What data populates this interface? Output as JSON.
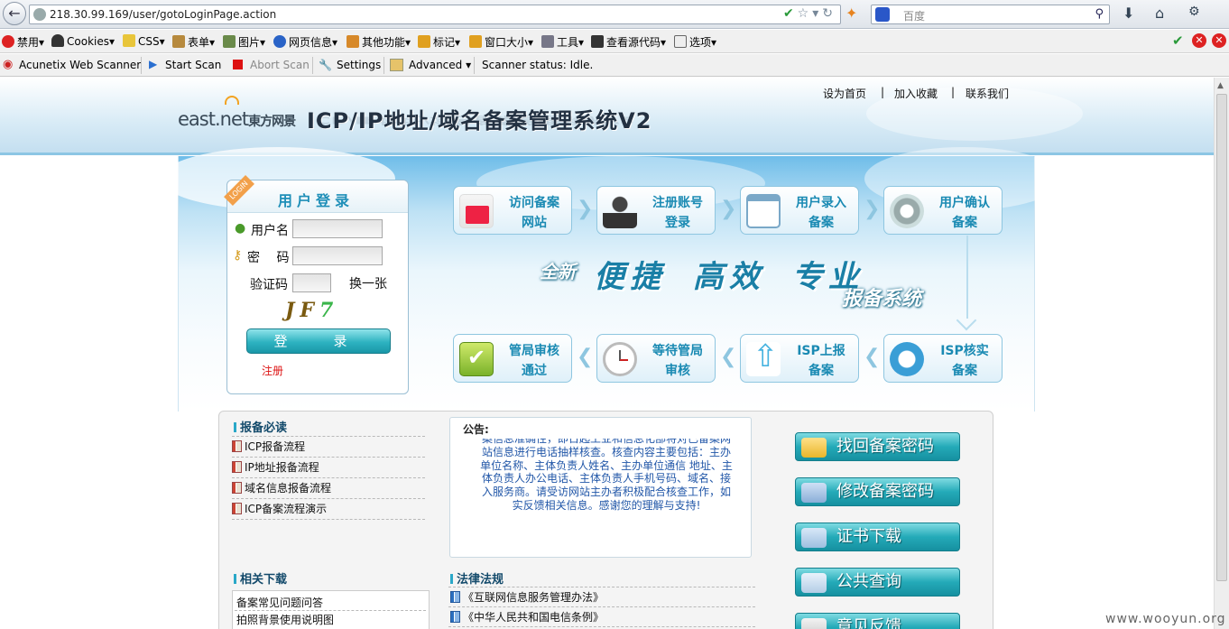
{
  "browser": {
    "url": "218.30.99.169/user/gotoLoginPage.action",
    "search_placeholder": "百度"
  },
  "webdev_toolbar": [
    "禁用",
    "Cookies",
    "CSS",
    "表单",
    "图片",
    "网页信息",
    "其他功能",
    "标记",
    "窗口大小",
    "工具",
    "查看源代码",
    "选项"
  ],
  "acunetix_bar": {
    "brand": "Acunetix Web Scanner",
    "start": "Start Scan",
    "abort": "Abort Scan",
    "settings": "Settings",
    "advanced": "Advanced",
    "status": "Scanner status: Idle."
  },
  "header": {
    "logo_en": "east.net",
    "logo_cn": "東方网景",
    "title": "ICP/IP地址/域名备案管理系统V2",
    "links": [
      "设为首页",
      "|",
      "加入收藏",
      "|",
      "联系我们"
    ]
  },
  "login": {
    "title": "用户登录",
    "tag": "LOGIN",
    "username_label": "用户名",
    "password_label": "密　 码",
    "captcha_label": "验证码",
    "refresh": "换一张",
    "captcha_text": "JF",
    "submit": "登　录",
    "register": "注册"
  },
  "flow": {
    "top": [
      {
        "line1": "访问备案",
        "line2": "网站"
      },
      {
        "line1": "注册账号",
        "line2": "登录"
      },
      {
        "line1": "用户录入",
        "line2": "备案"
      },
      {
        "line1": "用户确认",
        "line2": "备案"
      }
    ],
    "bottom": [
      {
        "line1": "管局审核",
        "line2": "通过"
      },
      {
        "line1": "等待管局",
        "line2": "审核"
      },
      {
        "line1": "ISP上报",
        "line2": "备案"
      },
      {
        "line1": "ISP核实",
        "line2": "备案"
      }
    ],
    "slogan_a": "全新",
    "slogan_b": "便捷 高效 专业",
    "slogan_c": "报备系统"
  },
  "must_read": {
    "title": "报备必读",
    "items": [
      "ICP报备流程",
      "IP地址报备流程",
      "域名信息报备流程",
      "ICP备案流程演示"
    ]
  },
  "notice": {
    "title": "公告:",
    "body": "案信息准确性，即日起工业和信息化部将对已备案网站信息进行电话抽样核查。核查内容主要包括：主办单位名称、主体负责人姓名、主办单位通信 地址、主体负责人办公电话、主体负责人手机号码、域名、接入服务商。请受访网站主办者积极配合核查工作，如实反馈相关信息。感谢您的理解与支持!"
  },
  "downloads": {
    "title": "相关下载",
    "items": [
      "备案常见问题问答",
      "拍照背景使用说明图"
    ]
  },
  "laws": {
    "title": "法律法规",
    "items": [
      "《互联网信息服务管理办法》",
      "《中华人民共和国电信条例》"
    ]
  },
  "side_buttons": [
    "找回备案密码",
    "修改备案密码",
    "证书下载",
    "公共查询",
    "意见反馈"
  ],
  "watermark": "www.wooyun.org",
  "colors": {
    "accent": "#1a8ab3",
    "button": "#24aab8",
    "register": "#dd1111"
  }
}
